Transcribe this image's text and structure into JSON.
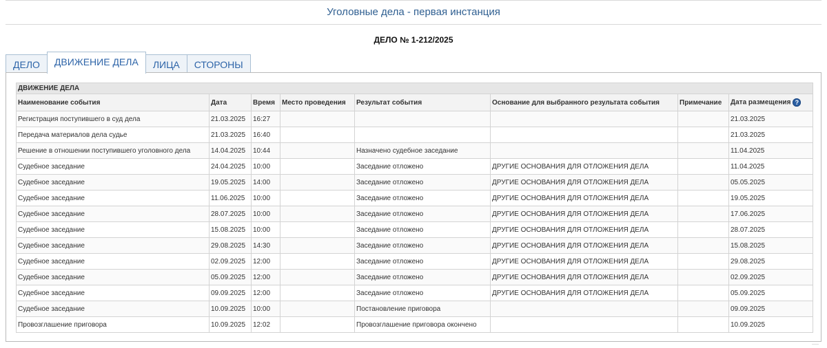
{
  "header": {
    "title": "Уголовные дела - первая инстанция"
  },
  "case": {
    "number": "ДЕЛО № 1-212/2025"
  },
  "tabs": [
    {
      "label": "ДЕЛО",
      "active": false
    },
    {
      "label": "ДВИЖЕНИЕ ДЕЛА",
      "active": true
    },
    {
      "label": "ЛИЦА",
      "active": false
    },
    {
      "label": "СТОРОНЫ",
      "active": false
    }
  ],
  "movement": {
    "section_title": "ДВИЖЕНИЕ ДЕЛА",
    "columns": [
      "Наименование события",
      "Дата",
      "Время",
      "Место проведения",
      "Результат события",
      "Основание для выбранного результата события",
      "Примечание",
      "Дата размещения"
    ],
    "help_icon": "question-icon",
    "rows": [
      [
        "Регистрация поступившего в суд дела",
        "21.03.2025",
        "16:27",
        "",
        "",
        "",
        "",
        "21.03.2025"
      ],
      [
        "Передача материалов дела судье",
        "21.03.2025",
        "16:40",
        "",
        "",
        "",
        "",
        "21.03.2025"
      ],
      [
        "Решение в отношении поступившего уголовного дела",
        "14.04.2025",
        "10:44",
        "",
        "Назначено судебное заседание",
        "",
        "",
        "11.04.2025"
      ],
      [
        "Судебное заседание",
        "24.04.2025",
        "10:00",
        "",
        "Заседание отложено",
        "ДРУГИЕ ОСНОВАНИЯ ДЛЯ ОТЛОЖЕНИЯ ДЕЛА",
        "",
        "11.04.2025"
      ],
      [
        "Судебное заседание",
        "19.05.2025",
        "14:00",
        "",
        "Заседание отложено",
        "ДРУГИЕ ОСНОВАНИЯ ДЛЯ ОТЛОЖЕНИЯ ДЕЛА",
        "",
        "05.05.2025"
      ],
      [
        "Судебное заседание",
        "11.06.2025",
        "10:00",
        "",
        "Заседание отложено",
        "ДРУГИЕ ОСНОВАНИЯ ДЛЯ ОТЛОЖЕНИЯ ДЕЛА",
        "",
        "19.05.2025"
      ],
      [
        "Судебное заседание",
        "28.07.2025",
        "10:00",
        "",
        "Заседание отложено",
        "ДРУГИЕ ОСНОВАНИЯ ДЛЯ ОТЛОЖЕНИЯ ДЕЛА",
        "",
        "17.06.2025"
      ],
      [
        "Судебное заседание",
        "15.08.2025",
        "10:00",
        "",
        "Заседание отложено",
        "ДРУГИЕ ОСНОВАНИЯ ДЛЯ ОТЛОЖЕНИЯ ДЕЛА",
        "",
        "28.07.2025"
      ],
      [
        "Судебное заседание",
        "29.08.2025",
        "14:30",
        "",
        "Заседание отложено",
        "ДРУГИЕ ОСНОВАНИЯ ДЛЯ ОТЛОЖЕНИЯ ДЕЛА",
        "",
        "15.08.2025"
      ],
      [
        "Судебное заседание",
        "02.09.2025",
        "12:00",
        "",
        "Заседание отложено",
        "ДРУГИЕ ОСНОВАНИЯ ДЛЯ ОТЛОЖЕНИЯ ДЕЛА",
        "",
        "29.08.2025"
      ],
      [
        "Судебное заседание",
        "05.09.2025",
        "12:00",
        "",
        "Заседание отложено",
        "ДРУГИЕ ОСНОВАНИЯ ДЛЯ ОТЛОЖЕНИЯ ДЕЛА",
        "",
        "02.09.2025"
      ],
      [
        "Судебное заседание",
        "09.09.2025",
        "12:00",
        "",
        "Заседание отложено",
        "ДРУГИЕ ОСНОВАНИЯ ДЛЯ ОТЛОЖЕНИЯ ДЕЛА",
        "",
        "05.09.2025"
      ],
      [
        "Судебное заседание",
        "10.09.2025",
        "10:00",
        "",
        "Постановление приговора",
        "",
        "",
        "09.09.2025"
      ],
      [
        "Провозглашение приговора",
        "10.09.2025",
        "12:02",
        "",
        "Провозглашение приговора окончено",
        "",
        "",
        "10.09.2025"
      ]
    ]
  },
  "colors": {
    "accent": "#2f5f91",
    "tab_text": "#2d64a8",
    "section_bg": "#e6e6e6"
  }
}
